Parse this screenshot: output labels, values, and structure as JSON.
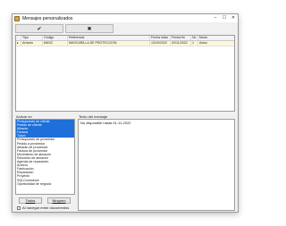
{
  "window": {
    "title": "Mensajes personalizados",
    "controls": {
      "minimize": "–",
      "maximize": "☐",
      "close": "✕"
    }
  },
  "toolbar": {
    "accept_label": "✔",
    "cancel_label": "✖"
  },
  "grid": {
    "columns": [
      "Tipo",
      "Código",
      "Referencia",
      "Fecha inicio",
      "Fecha fin",
      "Nv",
      "Modo"
    ],
    "rows": [
      {
        "sel": "",
        "tipo": "Artículo",
        "codigo": "MASC",
        "referencia": "MASCARILLA DE PROTECCION",
        "fecha_inicio": "13/10/2022",
        "fecha_fin": "02/11/2022",
        "nv": "1",
        "modo": "Aviso"
      }
    ]
  },
  "activar": {
    "label": "Activar en",
    "items": [
      {
        "label": "Presupuesto de cliente",
        "selected": true
      },
      {
        "label": "Pedido de cliente",
        "selected": true
      },
      {
        "label": "Albarán",
        "selected": true
      },
      {
        "label": "Factura",
        "selected": true
      },
      {
        "label": "Ticket",
        "selected": true
      },
      {
        "label": "Presupuesto de proveedor",
        "selected": false
      },
      {
        "label": "Pedido a proveedor",
        "selected": false
      },
      {
        "label": "Albarán de proveedor",
        "selected": false
      },
      {
        "label": "Factura de proveedor",
        "selected": false
      },
      {
        "label": "Movimiento de almacén",
        "selected": false
      },
      {
        "label": "Recuento de almacén",
        "selected": false
      },
      {
        "label": "Agenda de reparación",
        "selected": false
      },
      {
        "label": "Archivo",
        "selected": false
      },
      {
        "label": "Fabricación",
        "selected": false
      },
      {
        "label": "Reparación",
        "selected": false
      },
      {
        "label": "Proyecto",
        "selected": false
      },
      {
        "label": "SQLCommerce",
        "selected": false
      },
      {
        "label": "Oportunidad de negocio",
        "selected": false
      }
    ],
    "todos_label": "Todos",
    "ninguno_label": "Ninguno",
    "checkbox_label": "Al navegar entre documentos",
    "checkbox_checked": false
  },
  "mensaje": {
    "label": "Texto del mensaje",
    "text": "No disponible hasta 01-11-2022"
  }
}
